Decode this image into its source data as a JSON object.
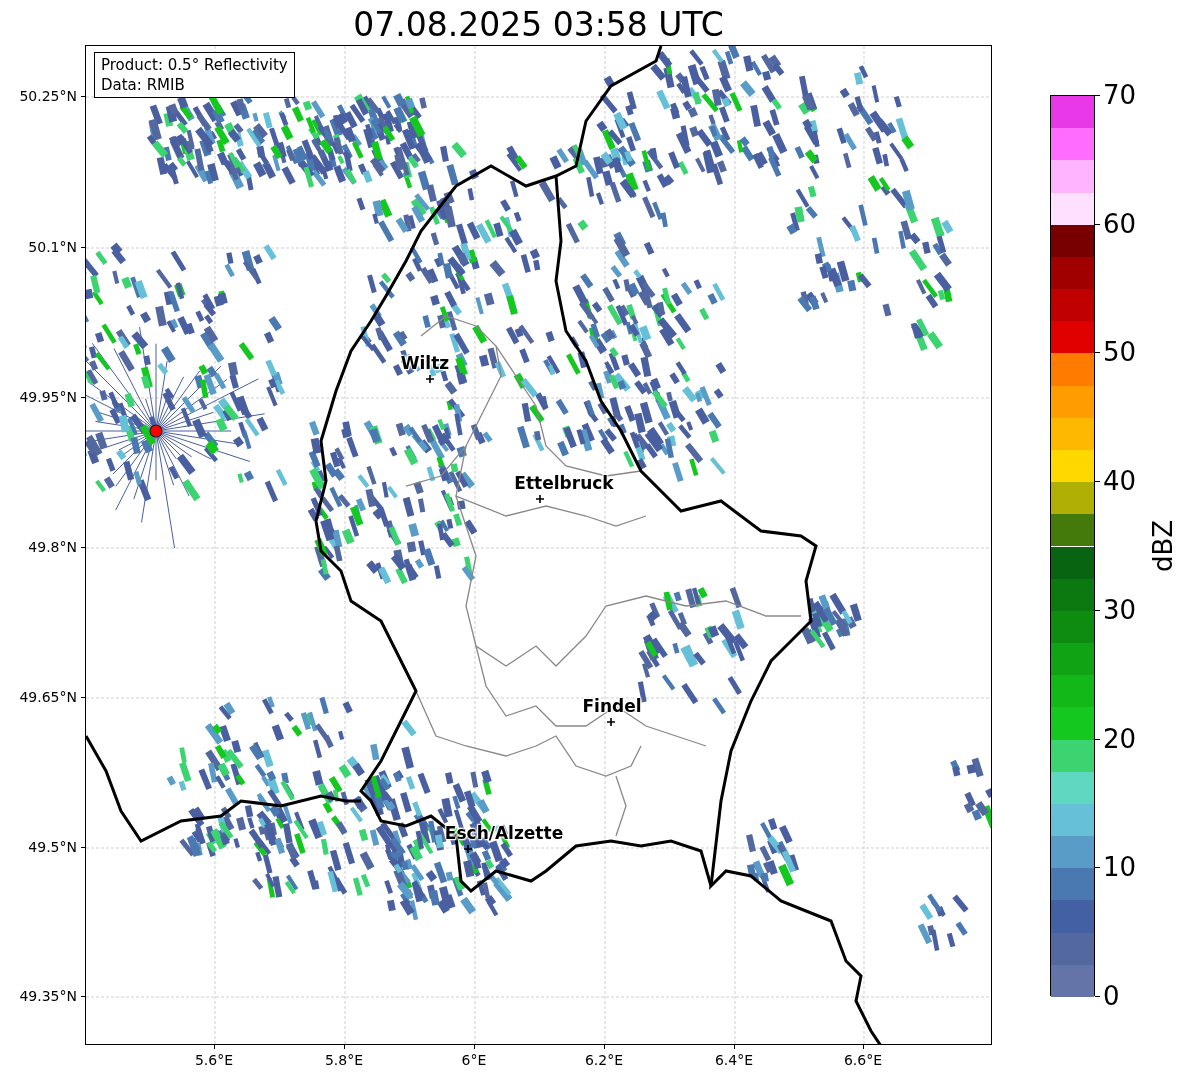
{
  "title": "07.08.2025 03:58 UTC",
  "info_box": {
    "lines": [
      "Product: 0.5° Reflectivity",
      "Data: RMIB"
    ]
  },
  "y_ticks": [
    "50.25°N",
    "50.1°N",
    "49.95°N",
    "49.8°N",
    "49.65°N",
    "49.5°N",
    "49.35°N"
  ],
  "x_ticks": [
    "5.6°E",
    "5.8°E",
    "6°E",
    "6.2°E",
    "6.4°E",
    "6.6°E"
  ],
  "cities": [
    {
      "name": "Wiltz"
    },
    {
      "name": "Ettelbruck"
    },
    {
      "name": "Findel"
    },
    {
      "name": "Esch/Alzette"
    }
  ],
  "colorbar": {
    "label": "dBZ",
    "ticks": [
      "70",
      "60",
      "50",
      "40",
      "30",
      "20",
      "10",
      "0"
    ],
    "bins": [
      {
        "color": "#e838e8"
      },
      {
        "color": "#ff6cff"
      },
      {
        "color": "#ffb4ff"
      },
      {
        "color": "#ffe0ff"
      },
      {
        "color": "#780000"
      },
      {
        "color": "#a00000"
      },
      {
        "color": "#c00000"
      },
      {
        "color": "#e00000"
      },
      {
        "color": "#ff7c00"
      },
      {
        "color": "#ff9c00"
      },
      {
        "color": "#ffb800"
      },
      {
        "color": "#ffd800"
      },
      {
        "color": "#b0b004"
      },
      {
        "color": "#447a0c"
      },
      {
        "color": "#086410"
      },
      {
        "color": "#0c7810"
      },
      {
        "color": "#0e8c10"
      },
      {
        "color": "#10a414"
      },
      {
        "color": "#12b818"
      },
      {
        "color": "#14c820"
      },
      {
        "color": "#3cd470"
      },
      {
        "color": "#5ed8c0"
      },
      {
        "color": "#66c0d8"
      },
      {
        "color": "#5a9cc8"
      },
      {
        "color": "#4a78b0"
      },
      {
        "color": "#4460a4"
      },
      {
        "color": "#5468a0"
      },
      {
        "color": "#6474a8"
      }
    ]
  }
}
